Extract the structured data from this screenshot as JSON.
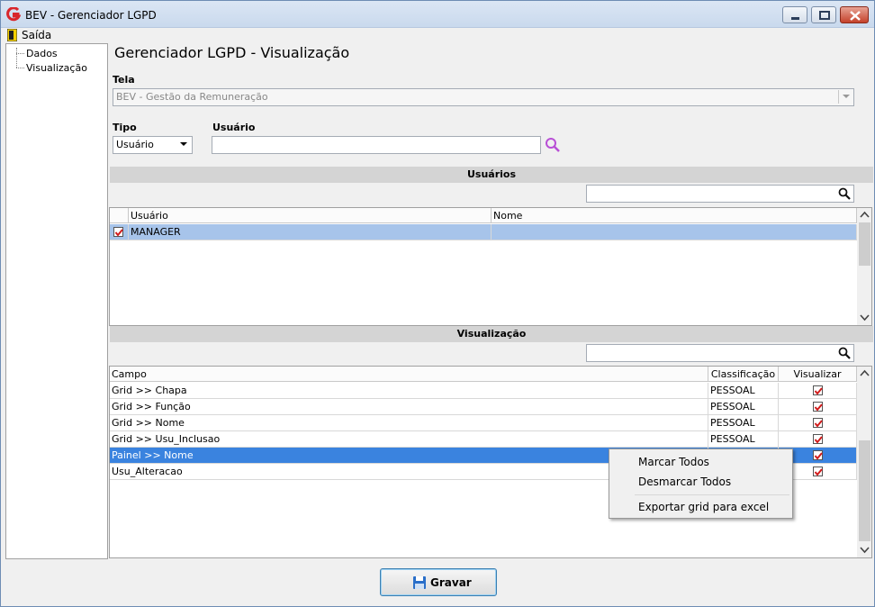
{
  "window": {
    "title": "BEV - Gerenciador LGPD"
  },
  "menu": {
    "exit_label": "Saída"
  },
  "tree": {
    "items": [
      "Dados",
      "Visualização"
    ]
  },
  "page": {
    "title": "Gerenciador LGPD - Visualização"
  },
  "form": {
    "tela_label": "Tela",
    "tela_value": "BEV - Gestão da Remuneração",
    "tipo_label": "Tipo",
    "tipo_value": "Usuário",
    "usuario_label": "Usuário",
    "usuario_value": ""
  },
  "users_section": {
    "title": "Usuários",
    "filter_value": "",
    "columns": [
      "Usuário",
      "Nome"
    ],
    "rows": [
      {
        "checked": true,
        "usuario": "MANAGER",
        "nome": ""
      }
    ]
  },
  "view_section": {
    "title": "Visualização",
    "filter_value": "",
    "columns": [
      "Campo",
      "Classificação",
      "Visualizar"
    ],
    "rows": [
      {
        "campo": "Grid >> Chapa",
        "classificacao": "PESSOAL",
        "visualizar": true
      },
      {
        "campo": "Grid >> Função",
        "classificacao": "PESSOAL",
        "visualizar": true
      },
      {
        "campo": "Grid >> Nome",
        "classificacao": "PESSOAL",
        "visualizar": true
      },
      {
        "campo": "Grid >> Usu_Inclusao",
        "classificacao": "PESSOAL",
        "visualizar": true
      },
      {
        "campo": "Painel >> Nome",
        "classificacao": "",
        "visualizar": true
      },
      {
        "campo": "Usu_Alteracao",
        "classificacao": "",
        "visualizar": true
      }
    ]
  },
  "context_menu": {
    "items": [
      "Marcar Todos",
      "Desmarcar Todos",
      "Exportar grid para excel"
    ]
  },
  "footer": {
    "save_label": "Gravar"
  },
  "colors": {
    "selection_light": "#a7c4ea",
    "selection_dark": "#3a83df",
    "brand_red": "#d9262b",
    "search_purple": "#b84fd6",
    "check_red": "#d11a1a"
  }
}
